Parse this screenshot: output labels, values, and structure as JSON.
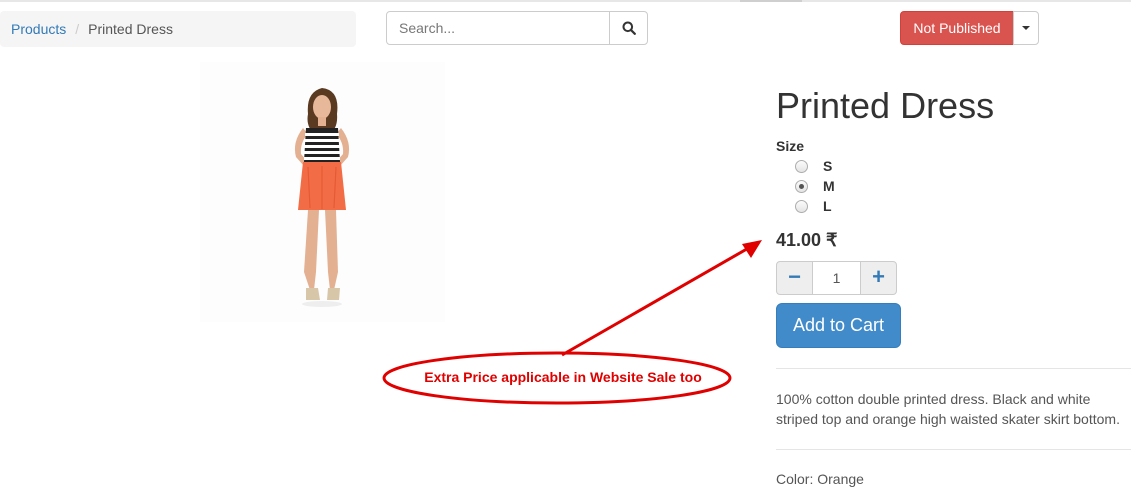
{
  "breadcrumb": {
    "link": "Products",
    "separator": "/",
    "current": "Printed Dress"
  },
  "search": {
    "placeholder": "Search...",
    "icon": "search-icon"
  },
  "publish": {
    "label": "Not Published",
    "color": "#d9534f"
  },
  "product": {
    "title": "Printed Dress",
    "size_label": "Size",
    "sizes": [
      {
        "label": "S",
        "checked": false
      },
      {
        "label": "M",
        "checked": true
      },
      {
        "label": "L",
        "checked": false
      }
    ],
    "price": "41.00 ₹",
    "quantity": "1",
    "add_to_cart": "Add to Cart",
    "description": "100% cotton double printed dress. Black and white striped top and orange high waisted skater skirt bottom.",
    "color_line": "Color: Orange"
  },
  "annotation": {
    "text": "Extra Price applicable in Website Sale too",
    "color": "#e00000"
  },
  "colors": {
    "link": "#337ab7",
    "primary": "#428bca",
    "danger": "#d9534f"
  }
}
